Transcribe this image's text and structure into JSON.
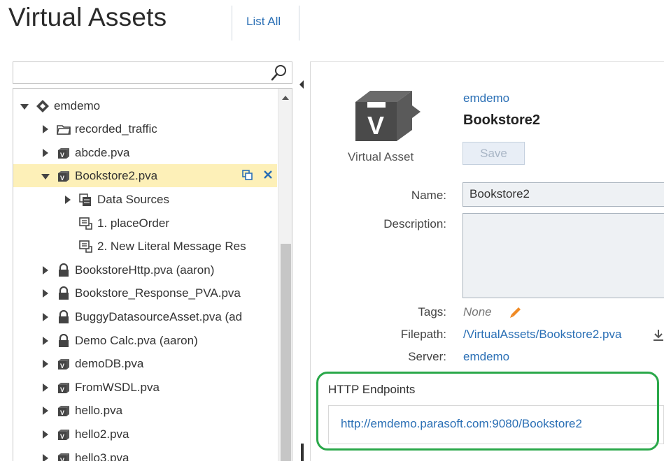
{
  "header": {
    "title": "Virtual Assets",
    "list_all": "List All"
  },
  "search": {
    "value": "",
    "icon": "search-icon"
  },
  "tree": {
    "items": [
      {
        "label": "emdemo",
        "icon": "server-icon",
        "caret": "down",
        "depth": 0
      },
      {
        "label": "recorded_traffic",
        "icon": "folder-icon",
        "caret": "right",
        "depth": 1
      },
      {
        "label": "abcde.pva",
        "icon": "virtual-asset-icon",
        "caret": "right",
        "depth": 1
      },
      {
        "label": "Bookstore2.pva",
        "icon": "virtual-asset-icon",
        "caret": "down",
        "depth": 1,
        "selected": true
      },
      {
        "label": "Data Sources",
        "icon": "data-sources-icon",
        "caret": "right",
        "depth": 2
      },
      {
        "label": "1. placeOrder",
        "icon": "responder-icon",
        "caret": "none",
        "depth": 2
      },
      {
        "label": "2. New Literal Message Res",
        "icon": "responder-icon",
        "caret": "none",
        "depth": 2
      },
      {
        "label": "BookstoreHttp.pva (aaron)",
        "icon": "lock-icon",
        "caret": "right",
        "depth": 1
      },
      {
        "label": "Bookstore_Response_PVA.pva",
        "icon": "lock-icon",
        "caret": "right",
        "depth": 1
      },
      {
        "label": "BuggyDatasourceAsset.pva (ad",
        "icon": "lock-icon",
        "caret": "right",
        "depth": 1
      },
      {
        "label": "Demo Calc.pva (aaron)",
        "icon": "lock-icon",
        "caret": "right",
        "depth": 1
      },
      {
        "label": "demoDB.pva",
        "icon": "virtual-asset-icon",
        "caret": "right",
        "depth": 1
      },
      {
        "label": "FromWSDL.pva",
        "icon": "virtual-asset-icon",
        "caret": "right",
        "depth": 1
      },
      {
        "label": "hello.pva",
        "icon": "virtual-asset-icon",
        "caret": "right",
        "depth": 1
      },
      {
        "label": "hello2.pva",
        "icon": "virtual-asset-icon",
        "caret": "right",
        "depth": 1
      },
      {
        "label": "hello3.pva",
        "icon": "virtual-asset-icon",
        "caret": "right",
        "depth": 1
      }
    ],
    "selected_actions": [
      "copy-icon",
      "close-icon"
    ]
  },
  "details": {
    "asset_type": "Virtual Asset",
    "server_link": "emdemo",
    "asset_name": "Bookstore2",
    "save_label": "Save",
    "fields": {
      "name_label": "Name:",
      "name_value": "Bookstore2",
      "description_label": "Description:",
      "description_value": "",
      "tags_label": "Tags:",
      "tags_value": "None",
      "filepath_label": "Filepath:",
      "filepath_value": "/VirtualAssets/Bookstore2.pva",
      "server_label": "Server:",
      "server_value": "emdemo"
    },
    "endpoints": {
      "label": "HTTP Endpoints",
      "url": "http://emdemo.parasoft.com:9080/Bookstore2"
    }
  },
  "colors": {
    "link": "#2a6fb5",
    "selected_row": "#fdf0b8",
    "highlight_box": "#2aa84a"
  }
}
